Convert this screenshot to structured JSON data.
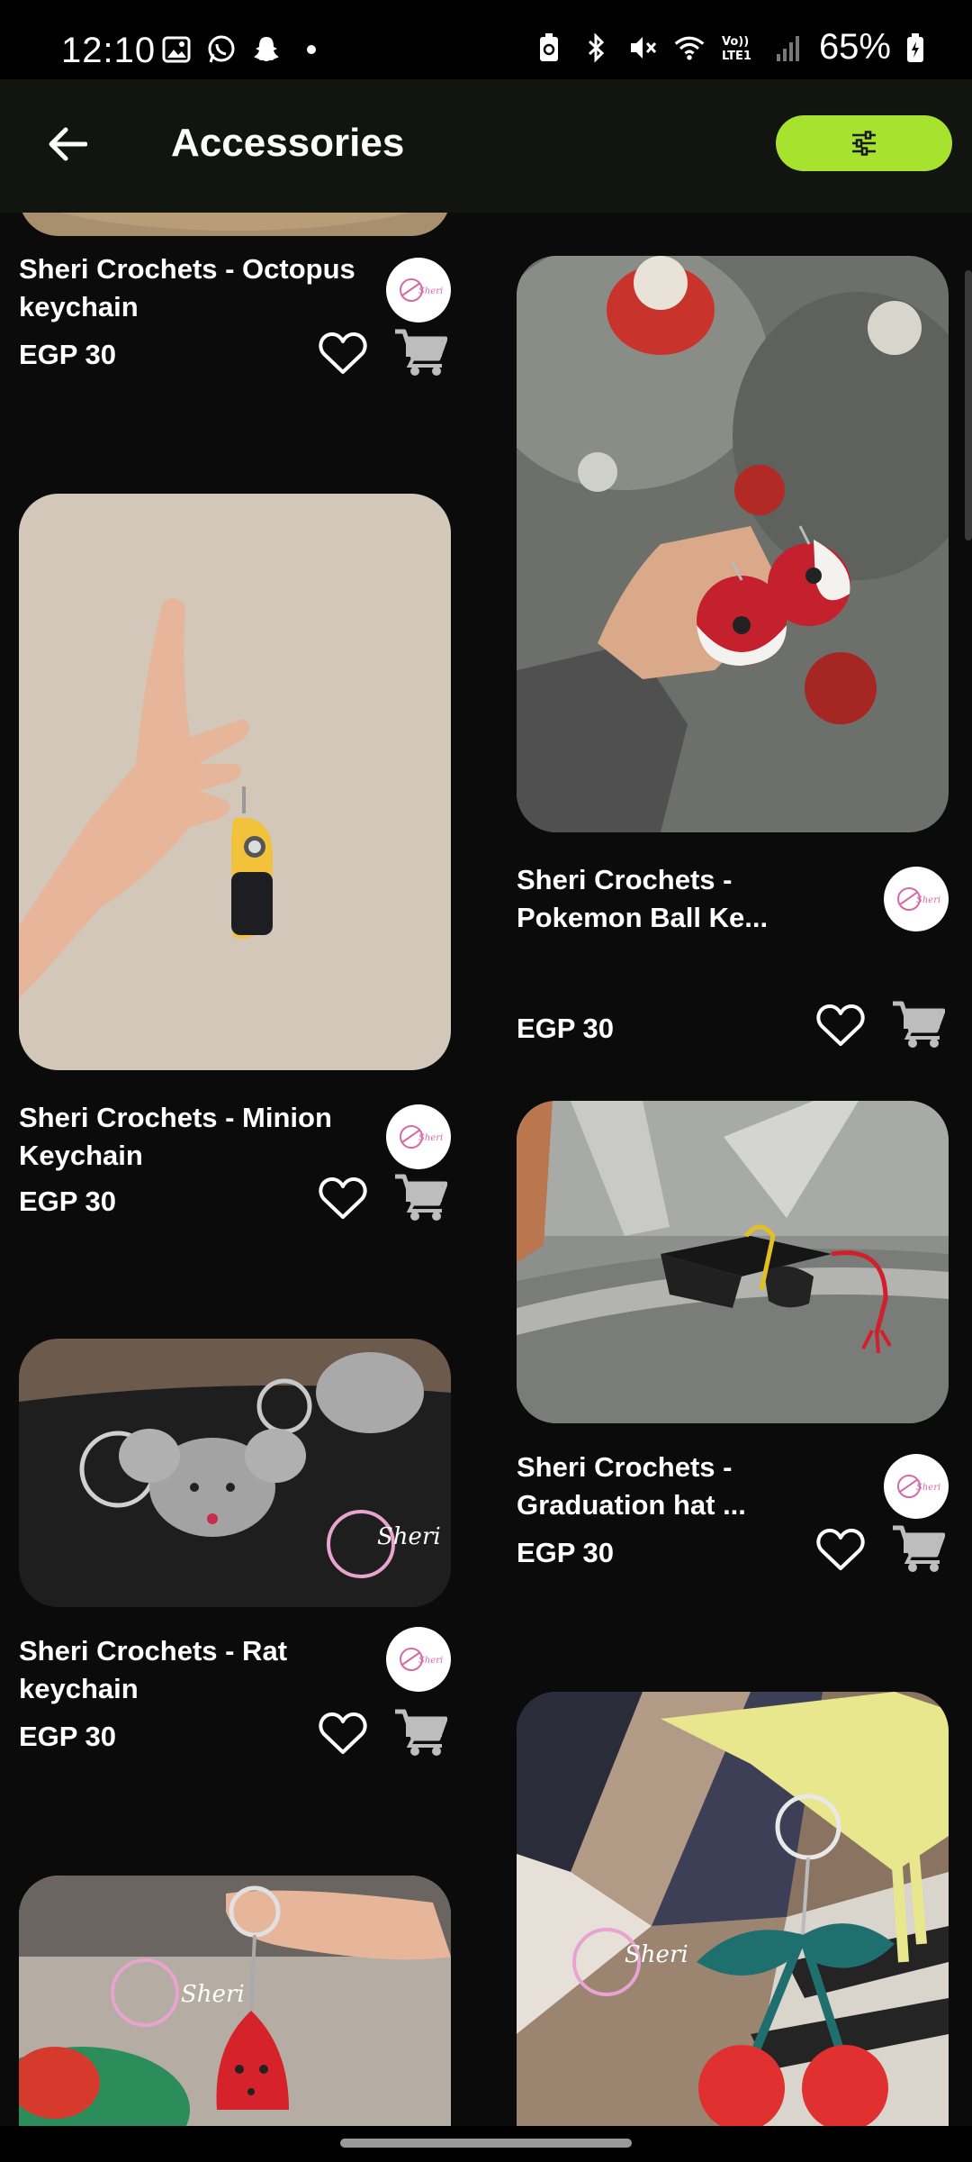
{
  "status_bar": {
    "time": "12:10",
    "battery": "65%",
    "left_icons": [
      "gallery-icon",
      "whatsapp-icon",
      "snapchat-icon",
      "dot-icon"
    ],
    "right_icons": [
      "battery-saver-icon",
      "bluetooth-icon",
      "mute-icon",
      "wifi-icon",
      "volte-icon",
      "signal-icon",
      "battery-icon"
    ]
  },
  "header": {
    "title": "Accessories",
    "back_icon": "arrow-left-icon",
    "filter_icon": "sliders-icon",
    "accent_color": "#a6e22e"
  },
  "products": [
    {
      "title": "Sheri Crochets - Octopus keychain",
      "price": "EGP 30"
    },
    {
      "title": "Sheri Crochets - Pokemon Ball Ke...",
      "price": "EGP 30"
    },
    {
      "title": "Sheri Crochets - Minion Keychain",
      "price": "EGP 30"
    },
    {
      "title": "Sheri Crochets - Graduation hat ...",
      "price": "EGP 30"
    },
    {
      "title": "Sheri Crochets - Rat keychain",
      "price": "EGP 30"
    }
  ],
  "watermark": "Sheri",
  "icons": {
    "favorite": "heart-outline-icon",
    "cart": "cart-icon",
    "seller": "sheri-logo-icon"
  }
}
